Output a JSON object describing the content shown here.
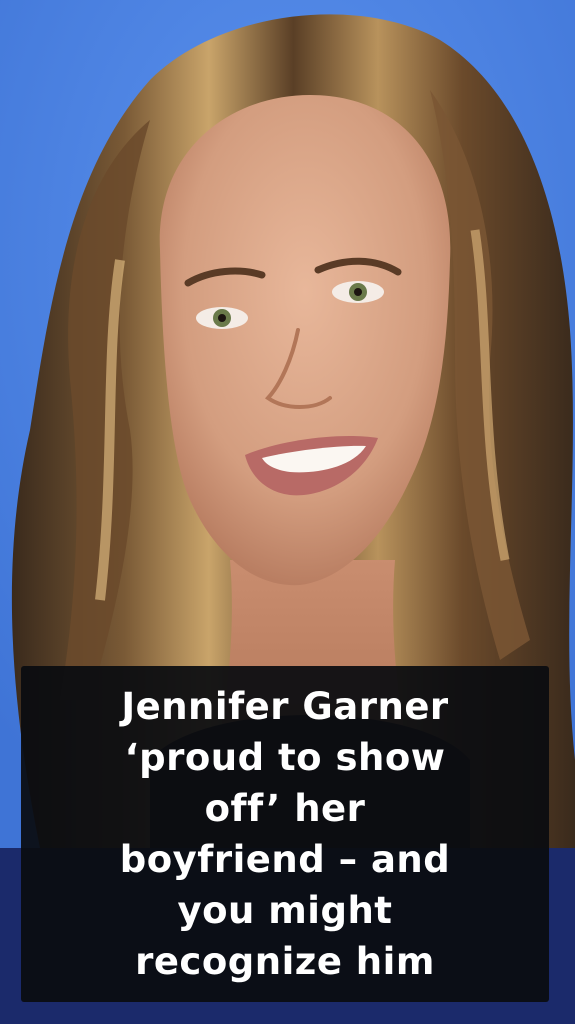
{
  "headline": {
    "line1": "Jennifer Garner",
    "line2": "‘proud to show",
    "line3": "off’ her",
    "line4": "boyfriend – and",
    "line5": "you might",
    "line6": "recognize him"
  },
  "colors": {
    "backdrop": "#4f86e6",
    "bottom_band": "#1b2a6b",
    "caption_box": "#0a0c10",
    "caption_text": "#ffffff"
  }
}
